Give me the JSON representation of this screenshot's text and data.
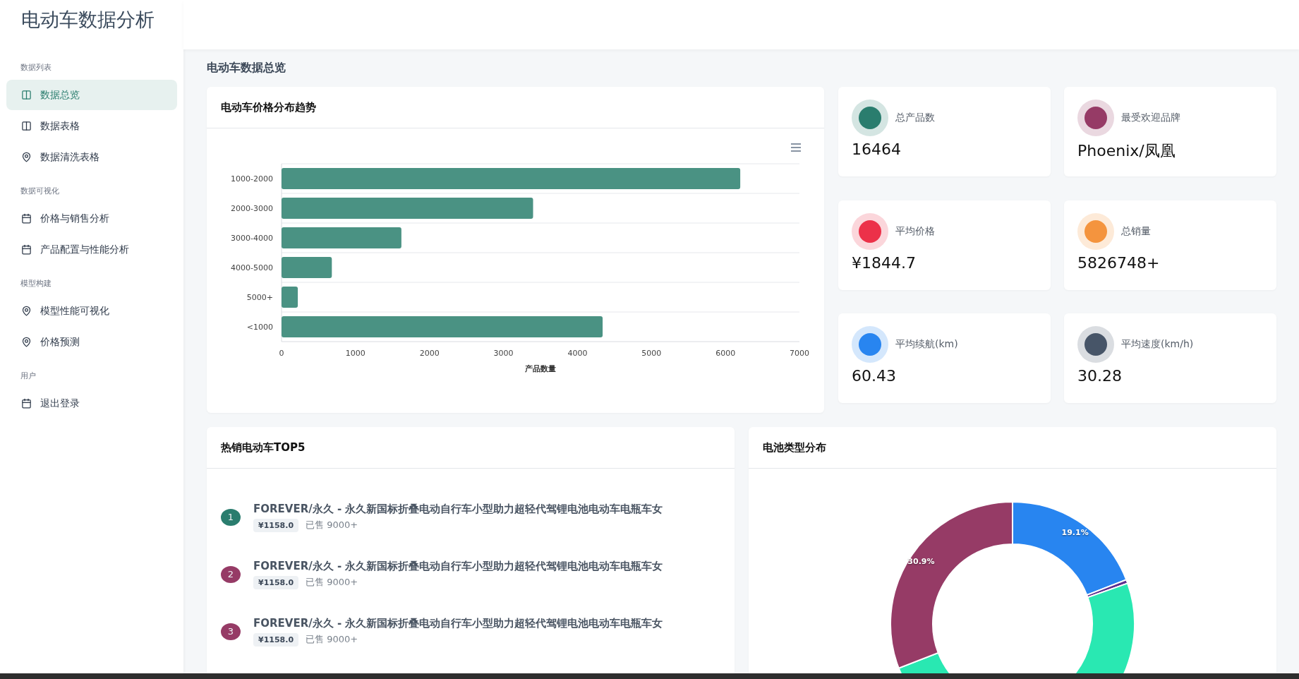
{
  "sidebar": {
    "title": "电动车数据分析",
    "groups": [
      {
        "heading": "数据列表",
        "items": [
          {
            "label": "数据总览",
            "selected": true
          },
          {
            "label": "数据表格",
            "selected": false
          },
          {
            "label": "数据清洗表格",
            "selected": false
          }
        ]
      },
      {
        "heading": "数据可视化",
        "items": [
          {
            "label": "价格与销售分析",
            "selected": false
          },
          {
            "label": "产品配置与性能分析",
            "selected": false
          }
        ]
      },
      {
        "heading": "模型构建",
        "items": [
          {
            "label": "模型性能可视化",
            "selected": false
          },
          {
            "label": "价格预测",
            "selected": false
          }
        ]
      },
      {
        "heading": "用户",
        "items": [
          {
            "label": "退出登录",
            "selected": false
          }
        ]
      }
    ]
  },
  "page_title": "电动车数据总览",
  "price_chart": {
    "title": "电动车价格分布趋势",
    "chart_data": {
      "type": "bar",
      "orientation": "horizontal",
      "xlabel": "产品数量",
      "categories": [
        "1000-2000",
        "2000-3000",
        "3000-4000",
        "4000-5000",
        "5000+",
        "<1000"
      ],
      "series": [
        {
          "color": "#4a9283",
          "values": [
            6200,
            3400,
            1620,
            680,
            220,
            4340
          ]
        }
      ],
      "xlim": [
        0,
        7000
      ],
      "xticks": [
        0,
        1000,
        2000,
        3000,
        4000,
        5000,
        6000,
        7000
      ]
    }
  },
  "stats": [
    {
      "label": "总产品数",
      "value": "16464",
      "color": "#2a7d6e"
    },
    {
      "label": "最受欢迎品牌",
      "value": "Phoenix/凤凰",
      "color": "#963b66"
    },
    {
      "label": "平均价格",
      "value": "¥1844.7",
      "color": "#ec3149"
    },
    {
      "label": "总销量",
      "value": "5826748+",
      "color": "#f4943e"
    },
    {
      "label": "平均续航(km)",
      "value": "60.43",
      "color": "#2885f0"
    },
    {
      "label": "平均速度(km/h)",
      "value": "30.28",
      "color": "#475568"
    }
  ],
  "top5": {
    "title": "热销电动车TOP5",
    "items": [
      {
        "rank": "1",
        "color": "#2a7d6e",
        "name": "FOREVER/永久 - 永久新国标折叠电动自行车小型助力超轻代驾锂电池电动车电瓶车女",
        "price": "¥1158.0",
        "sold": "已售 9000+"
      },
      {
        "rank": "2",
        "color": "#963b66",
        "name": "FOREVER/永久 - 永久新国标折叠电动自行车小型助力超轻代驾锂电池电动车电瓶车女",
        "price": "¥1158.0",
        "sold": "已售 9000+"
      },
      {
        "rank": "3",
        "color": "#963b66",
        "name": "FOREVER/永久 - 永久新国标折叠电动自行车小型助力超轻代驾锂电池电动车电瓶车女",
        "price": "¥1158.0",
        "sold": "已售 9000+"
      }
    ]
  },
  "battery_chart": {
    "title": "电池类型分布",
    "chart_data": {
      "type": "donut",
      "series": [
        {
          "values": [
            19.1,
            0.5,
            35.0,
            14.5,
            30.9
          ]
        }
      ],
      "colors": [
        "#2885f0",
        "#5b2d8e",
        "#29e8b2",
        "#29e8b2",
        "#963b66"
      ],
      "value_labels": [
        "19.1%",
        null,
        null,
        null,
        "30.9%"
      ]
    }
  }
}
